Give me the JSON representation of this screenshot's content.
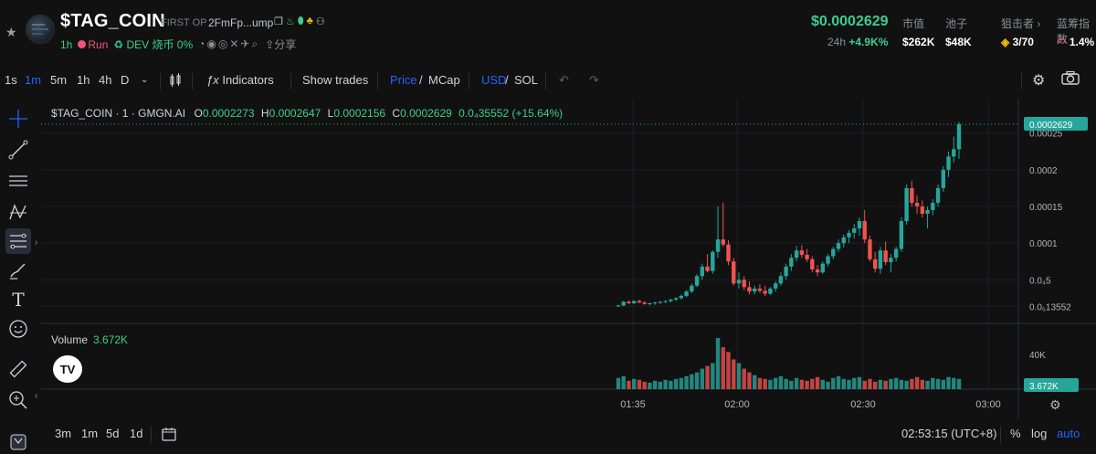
{
  "header": {
    "token_name": "$TAG_COIN",
    "first_op": "FIRST OP",
    "address": "2FmFp...ump",
    "age": "1h",
    "run": "Run",
    "dev_label": "DEV 烧币 0%",
    "share": "分享",
    "price": "$0.0002629",
    "change_label": "24h",
    "change_value": "+4.9K%",
    "stats": [
      {
        "label": "市值",
        "value": "$262K"
      },
      {
        "label": "池子",
        "value": "$48K"
      },
      {
        "label": "狙击者 ›",
        "value": "3/70"
      },
      {
        "label": "蓝筹指数",
        "value": "1.4%"
      }
    ]
  },
  "toolbar": {
    "intervals": [
      "1s",
      "1m",
      "5m",
      "1h",
      "4h",
      "D"
    ],
    "active_interval": "1m",
    "indicators": "Indicators",
    "show_trades": "Show trades",
    "price": "Price",
    "slash1": "/",
    "mcap": "MCap",
    "usd": "USD",
    "slash2": "/",
    "sol": "SOL"
  },
  "legend": {
    "symbol": "$TAG_COIN · 1 · GMGN.AI",
    "o_label": "O",
    "o": "0.0002273",
    "h_label": "H",
    "h": "0.0002647",
    "l_label": "L",
    "l": "0.0002156",
    "c_label": "C",
    "c": "0.0002629",
    "change": "0.0₄35552 (+15.64%)"
  },
  "volume_legend": {
    "label": "Volume",
    "value": "3.672K"
  },
  "price_axis": {
    "ticks": [
      "0.00025",
      "0.0002",
      "0.00015",
      "0.0001",
      "0.0₄5",
      "0.0₅13552"
    ],
    "current": "0.0002629",
    "vol_ticks": [
      "40K"
    ],
    "vol_current": "3.672K"
  },
  "time_axis": {
    "ticks": [
      "01:35",
      "02:00",
      "02:30",
      "03:00"
    ]
  },
  "bottombar": {
    "ranges": [
      "3m",
      "1m",
      "5d",
      "1d"
    ],
    "clock": "02:53:15 (UTC+8)",
    "pct": "%",
    "log": "log",
    "auto": "auto"
  },
  "colors": {
    "up": "#26a69a",
    "down": "#ef5350",
    "accent": "#2962ff",
    "green_text": "#3ccf8e"
  },
  "chart_data": {
    "type": "candlestick",
    "x_ticks": [
      "01:35",
      "02:00",
      "02:30",
      "03:00"
    ],
    "ylim": [
      1e-05,
      0.00027
    ],
    "candles": [
      [
        1.4e-05,
        1.6e-05,
        1.3e-05,
        1.5e-05
      ],
      [
        1.5e-05,
        2.1e-05,
        1.4e-05,
        2e-05
      ],
      [
        2e-05,
        2.2e-05,
        1.7e-05,
        1.8e-05
      ],
      [
        1.8e-05,
        2.2e-05,
        1.7e-05,
        2.1e-05
      ],
      [
        2.1e-05,
        2.3e-05,
        1.8e-05,
        1.9e-05
      ],
      [
        1.9e-05,
        2.1e-05,
        1.6e-05,
        1.7e-05
      ],
      [
        1.7e-05,
        1.9e-05,
        1.5e-05,
        1.8e-05
      ],
      [
        1.8e-05,
        2e-05,
        1.6e-05,
        1.9e-05
      ],
      [
        1.9e-05,
        2.1e-05,
        1.7e-05,
        2e-05
      ],
      [
        2e-05,
        2.2e-05,
        1.8e-05,
        2.1e-05
      ],
      [
        2.1e-05,
        2.4e-05,
        1.9e-05,
        2.3e-05
      ],
      [
        2.3e-05,
        2.6e-05,
        2.1e-05,
        2.5e-05
      ],
      [
        2.5e-05,
        3e-05,
        2.3e-05,
        2.8e-05
      ],
      [
        2.8e-05,
        3.6e-05,
        2.6e-05,
        3.4e-05
      ],
      [
        3.4e-05,
        4.5e-05,
        3.2e-05,
        4.2e-05
      ],
      [
        4.2e-05,
        5.8e-05,
        4e-05,
        5.5e-05
      ],
      [
        5.5e-05,
        7.2e-05,
        5e-05,
        6.8e-05
      ],
      [
        6.8e-05,
        8.5e-05,
        6e-05,
        6.2e-05
      ],
      [
        6.2e-05,
        9e-05,
        5.8e-05,
        8.8e-05
      ],
      [
        8.8e-05,
        0.00015,
        8e-05,
        0.000105
      ],
      [
        0.000105,
        0.000155,
        9.5e-05,
        9.8e-05
      ],
      [
        9.8e-05,
        0.000104,
        7e-05,
        7.5e-05
      ],
      [
        7.5e-05,
        8e-05,
        4.2e-05,
        4.5e-05
      ],
      [
        4.5e-05,
        6e-05,
        3.8e-05,
        5e-05
      ],
      [
        5e-05,
        5.5e-05,
        3.6e-05,
        4e-05
      ],
      [
        4e-05,
        4.8e-05,
        3e-05,
        3.4e-05
      ],
      [
        3.4e-05,
        4.2e-05,
        3e-05,
        3.8e-05
      ],
      [
        3.8e-05,
        4.4e-05,
        3.2e-05,
        3.5e-05
      ],
      [
        3.5e-05,
        4.2e-05,
        2.8e-05,
        3.1e-05
      ],
      [
        3.1e-05,
        4e-05,
        2.9e-05,
        3.8e-05
      ],
      [
        3.8e-05,
        4.8e-05,
        3.4e-05,
        4.5e-05
      ],
      [
        4.5e-05,
        6e-05,
        4.2e-05,
        5.5e-05
      ],
      [
        5.5e-05,
        7.2e-05,
        5e-05,
        6.8e-05
      ],
      [
        6.8e-05,
        8.5e-05,
        6.2e-05,
        8e-05
      ],
      [
        8e-05,
        9.6e-05,
        7.5e-05,
        9e-05
      ],
      [
        9e-05,
        9.7e-05,
        8e-05,
        8.4e-05
      ],
      [
        8.4e-05,
        9.2e-05,
        7.4e-05,
        7.8e-05
      ],
      [
        7.8e-05,
        8.2e-05,
        6e-05,
        6.4e-05
      ],
      [
        6.4e-05,
        7e-05,
        5.5e-05,
        6e-05
      ],
      [
        6e-05,
        7.5e-05,
        5.8e-05,
        7.2e-05
      ],
      [
        7.2e-05,
        8.5e-05,
        6.8e-05,
        8.2e-05
      ],
      [
        8.2e-05,
        9.5e-05,
        7.8e-05,
        9.2e-05
      ],
      [
        9.2e-05,
        0.000105,
        8.8e-05,
        0.0001
      ],
      [
        0.0001,
        0.000112,
        9.4e-05,
        0.000108
      ],
      [
        0.000108,
        0.000118,
        0.0001,
        0.000114
      ],
      [
        0.000114,
        0.000126,
        0.000106,
        0.00012
      ],
      [
        0.00012,
        0.000135,
        0.00011,
        0.00013
      ],
      [
        0.00013,
        0.000145,
        0.0001,
        0.000105
      ],
      [
        0.000105,
        0.00011,
        7.5e-05,
        7.8e-05
      ],
      [
        7.8e-05,
        8.8e-05,
        6e-05,
        6.5e-05
      ],
      [
        6.5e-05,
        9.5e-05,
        5.8e-05,
        9e-05
      ],
      [
        9e-05,
        0.000102,
        7e-05,
        7.4e-05
      ],
      [
        7.4e-05,
        8.5e-05,
        6e-05,
        8e-05
      ],
      [
        8e-05,
        9.5e-05,
        7.5e-05,
        9.2e-05
      ],
      [
        9.2e-05,
        0.000135,
        8.8e-05,
        0.00013
      ],
      [
        0.00013,
        0.00018,
        0.000125,
        0.000175
      ],
      [
        0.000175,
        0.000185,
        0.00015,
        0.000155
      ],
      [
        0.000155,
        0.000165,
        0.00014,
        0.00015
      ],
      [
        0.00015,
        0.000158,
        0.000135,
        0.00014
      ],
      [
        0.00014,
        0.00015,
        0.00012,
        0.000145
      ],
      [
        0.000145,
        0.00016,
        0.000138,
        0.000155
      ],
      [
        0.000155,
        0.00018,
        0.00015,
        0.000175
      ],
      [
        0.000175,
        0.000205,
        0.00017,
        0.0002
      ],
      [
        0.0002,
        0.000225,
        0.00019,
        0.000218
      ],
      [
        0.000218,
        0.000245,
        0.00021,
        0.000228
      ],
      [
        0.000228,
        0.000265,
        0.000215,
        0.000262
      ]
    ],
    "volume": [
      12,
      14,
      9,
      11,
      10,
      8,
      7,
      9,
      8,
      10,
      9,
      11,
      12,
      14,
      16,
      18,
      22,
      25,
      28,
      55,
      45,
      40,
      32,
      28,
      22,
      18,
      15,
      12,
      11,
      10,
      12,
      14,
      11,
      9,
      12,
      10,
      9,
      11,
      13,
      10,
      8,
      12,
      14,
      11,
      10,
      12,
      13,
      9,
      11,
      8,
      10,
      9,
      11,
      12,
      10,
      9,
      11,
      13,
      10,
      9,
      12,
      11,
      10,
      13,
      12,
      11
    ]
  }
}
